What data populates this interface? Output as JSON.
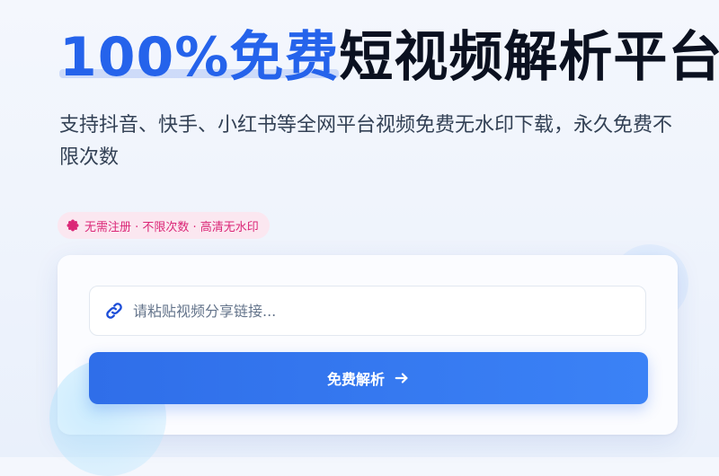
{
  "hero": {
    "title_accent": "100%免费",
    "title_rest": "短视频解析平台",
    "subtitle": "支持抖音、快手、小红书等全网平台视频免费无水印下载，永久免费不限次数"
  },
  "badge": {
    "icon": "flower-icon",
    "text": "无需注册 · 不限次数 · 高清无水印"
  },
  "form": {
    "input_icon": "link-icon",
    "input_placeholder": "请粘贴视频分享链接...",
    "input_value": "",
    "button_label": "免费解析",
    "button_icon": "arrow-right-icon"
  },
  "colors": {
    "accent": "#2563eb",
    "badge_bg": "#fbe7f0",
    "badge_text": "#db2777",
    "button_start": "#2f6ee9",
    "button_end": "#3b82f6"
  }
}
